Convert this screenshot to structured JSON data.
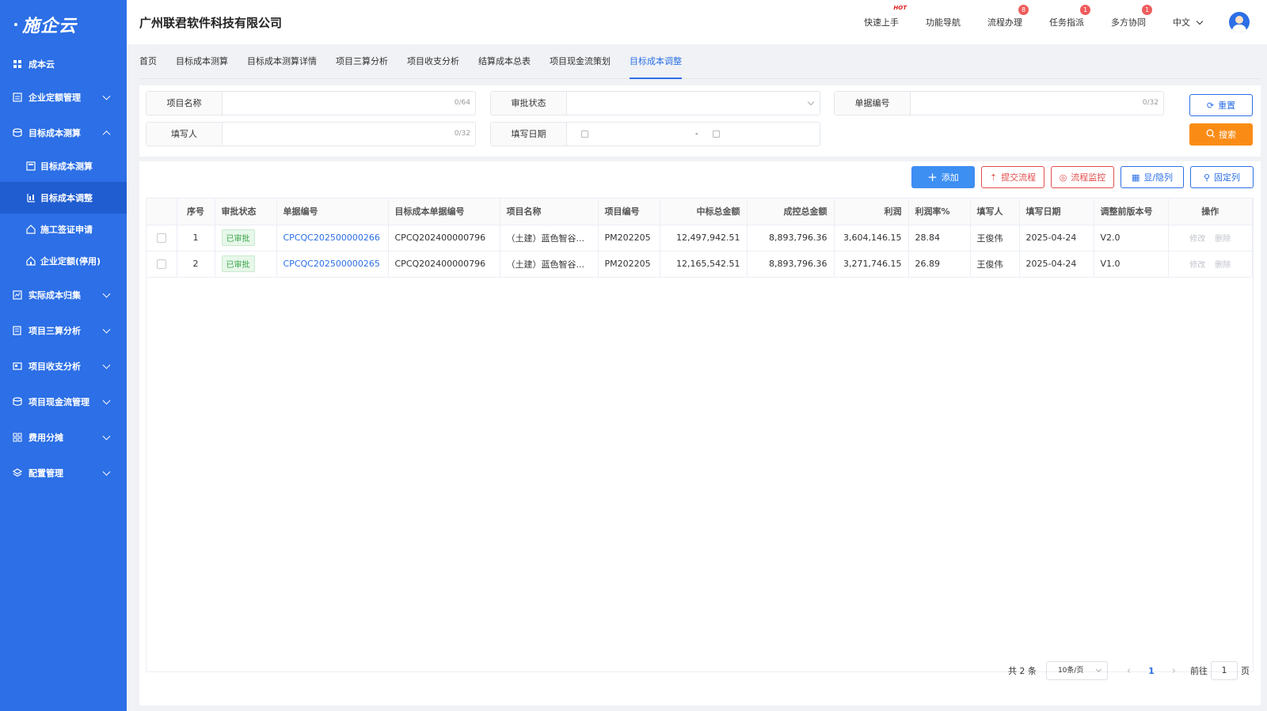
{
  "app": {
    "logo": "施企云"
  },
  "sidebar": {
    "items": [
      {
        "label": "成本云"
      },
      {
        "label": "企业定额管理"
      },
      {
        "label": "目标成本测算"
      },
      {
        "label": "实际成本归集"
      },
      {
        "label": "项目三算分析"
      },
      {
        "label": "项目收支分析"
      },
      {
        "label": "项目现金流管理"
      },
      {
        "label": "费用分摊"
      },
      {
        "label": "配置管理"
      }
    ],
    "sub_items": [
      {
        "label": "目标成本测算"
      },
      {
        "label": "目标成本调整"
      },
      {
        "label": "施工签证申请"
      },
      {
        "label": "企业定额(停用)"
      }
    ]
  },
  "header": {
    "company": "广州联君软件科技有限公司",
    "actions": [
      {
        "label": "快速上手",
        "tag": "HOT"
      },
      {
        "label": "功能导航"
      },
      {
        "label": "流程办理",
        "badge": "8"
      },
      {
        "label": "任务指派",
        "badge": "1"
      },
      {
        "label": "多方协同",
        "badge": "1"
      }
    ],
    "language": "中文"
  },
  "tabs": [
    {
      "label": "首页"
    },
    {
      "label": "目标成本测算"
    },
    {
      "label": "目标成本测算详情"
    },
    {
      "label": "项目三算分析"
    },
    {
      "label": "项目收支分析"
    },
    {
      "label": "结算成本总表"
    },
    {
      "label": "项目现金流策划"
    },
    {
      "label": "目标成本调整",
      "active": true
    }
  ],
  "filters": {
    "project_name": {
      "label": "项目名称",
      "counter": "0/64"
    },
    "approval_status": {
      "label": "审批状态"
    },
    "doc_no": {
      "label": "单据编号",
      "counter": "0/32"
    },
    "filler": {
      "label": "填写人",
      "counter": "0/32"
    },
    "fill_date": {
      "label": "填写日期",
      "separator": "-"
    },
    "reset_label": "重置",
    "search_label": "搜索"
  },
  "toolbar": {
    "add": "添加",
    "submit_flow": "提交流程",
    "flow_monitor": "流程监控",
    "toggle_columns": "显/隐列",
    "fix_columns": "固定列"
  },
  "table": {
    "columns": [
      "序号",
      "审批状态",
      "单据编号",
      "目标成本单据编号",
      "项目名称",
      "项目编号",
      "中标总金额",
      "成控总金额",
      "利润",
      "利润率%",
      "填写人",
      "填写日期",
      "调整前版本号",
      "操作"
    ],
    "rows": [
      {
        "no": "1",
        "status": "已审批",
        "doc_no": "CPCQC202500000266",
        "target_doc_no": "CPCQ202400000796",
        "project_name": "（土建）蓝色智谷...",
        "project_code": "PM202205",
        "bid_total": "12,497,942.51",
        "control_total": "8,893,796.36",
        "profit": "3,604,146.15",
        "profit_rate": "28.84",
        "filler": "王俊伟",
        "date": "2025-04-24",
        "prev_version": "V2.0",
        "edit": "修改",
        "delete": "删除"
      },
      {
        "no": "2",
        "status": "已审批",
        "doc_no": "CPCQC202500000265",
        "target_doc_no": "CPCQ202400000796",
        "project_name": "（土建）蓝色智谷...",
        "project_code": "PM202205",
        "bid_total": "12,165,542.51",
        "control_total": "8,893,796.36",
        "profit": "3,271,746.15",
        "profit_rate": "26.89",
        "filler": "王俊伟",
        "date": "2025-04-24",
        "prev_version": "V1.0",
        "edit": "修改",
        "delete": "删除"
      }
    ]
  },
  "pagination": {
    "total_text": "共 2 条",
    "page_size": "10条/页",
    "current_page": "1",
    "goto_prefix": "前往",
    "goto_value": "1",
    "goto_suffix": "页"
  },
  "colors": {
    "primary": "#2c6fe6",
    "warning": "#fa8c16",
    "danger": "#e34d4d",
    "success": "#3aa54a"
  }
}
